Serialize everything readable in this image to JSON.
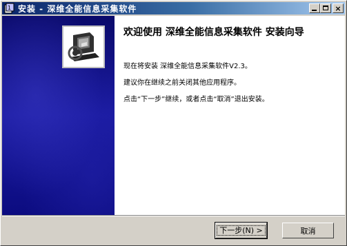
{
  "window": {
    "title": "安装 - 深维全能信息采集软件"
  },
  "title_buttons": {
    "minimize": "minimize",
    "maximize": "maximize",
    "close": "×"
  },
  "wizard": {
    "heading": "欢迎使用 深维全能信息采集软件 安装向导",
    "paragraphs": [
      "现在将安装 深维全能信息采集软件V2.3。",
      "建议你在继续之前关闭其他应用程序。",
      "点击“下一步”继续，或者点击“取消”退出安装。"
    ]
  },
  "buttons": {
    "next": "下一步(N) >",
    "cancel": "取消"
  },
  "colors": {
    "titlebar_start": "#0a246a",
    "titlebar_end": "#a6caf0",
    "side_panel": "#1a1aa0",
    "window_bg": "#d4d0c8"
  },
  "icons": {
    "app": "installer-icon",
    "logo": "installer-logo-icon"
  }
}
